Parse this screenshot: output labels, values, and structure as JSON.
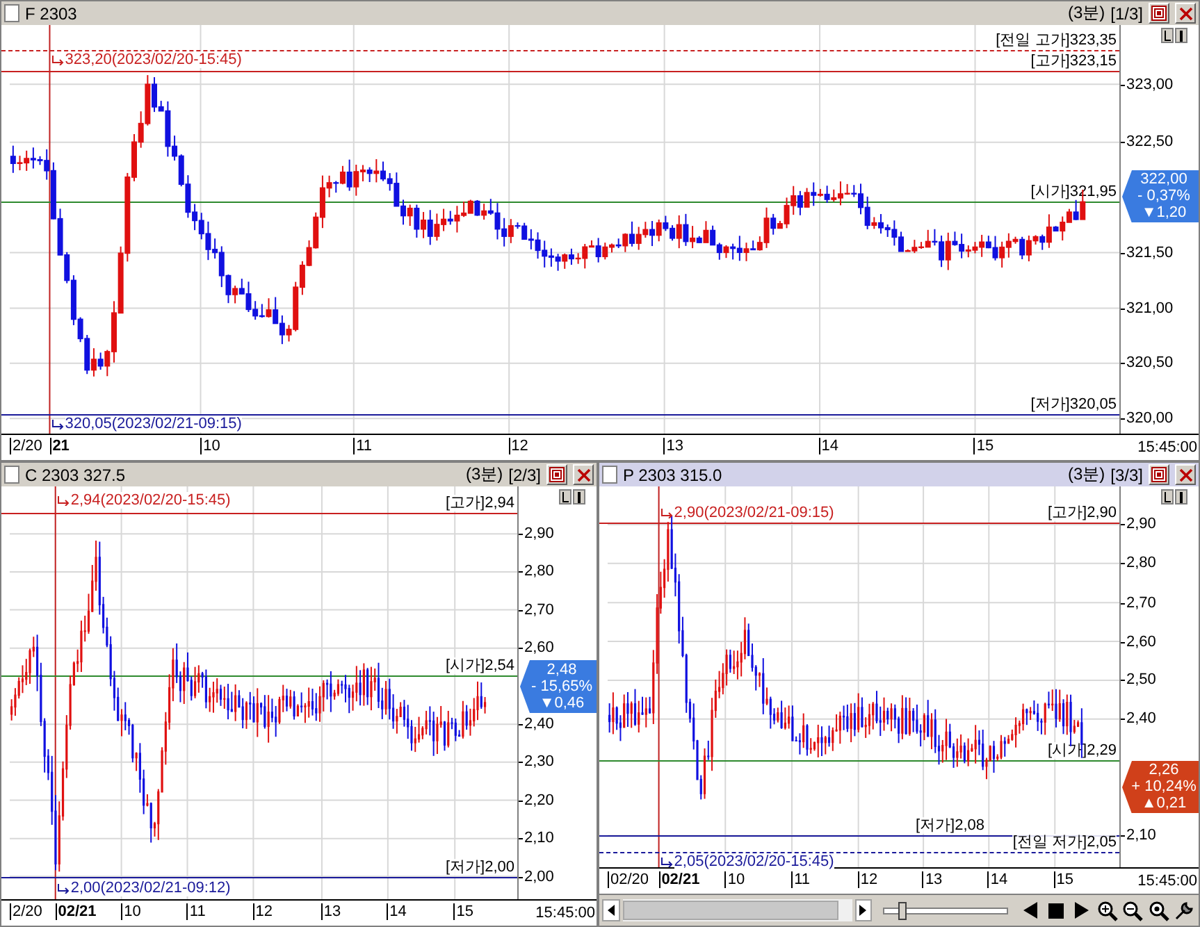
{
  "panels": [
    {
      "title": "F 2303",
      "interval": "(3분)",
      "page": "[1/3]",
      "active": false,
      "y_ticks": [
        "323,00",
        "322,50",
        "321,50",
        "321,00",
        "320,50",
        "320,00"
      ],
      "reference_lines": [
        {
          "kind": "prev_high",
          "label": "[전일 고가]323,35"
        },
        {
          "kind": "high",
          "label": "[고가]323,15"
        },
        {
          "kind": "open",
          "label": "[시가]321,95"
        },
        {
          "kind": "low",
          "label": "[저가]320,05"
        }
      ],
      "annotations": [
        {
          "kind": "high",
          "text": "323,20(2023/02/20-15:45)"
        },
        {
          "kind": "low",
          "text": "320,05(2023/02/21-09:15)"
        }
      ],
      "price_tag": {
        "rising": false,
        "price": "322,00",
        "change_percent": "- 0,37%",
        "change": "▼1,20"
      },
      "x_labels": [
        {
          "text": "2/20",
          "bold": false
        },
        {
          "text": "21",
          "bold": true
        },
        {
          "text": "10",
          "bold": false
        },
        {
          "text": "11",
          "bold": false
        },
        {
          "text": "12",
          "bold": false
        },
        {
          "text": "13",
          "bold": false
        },
        {
          "text": "14",
          "bold": false
        },
        {
          "text": "15",
          "bold": false
        }
      ],
      "x_end": "15:45:00"
    },
    {
      "title": "C 2303 327.5",
      "interval": "(3분)",
      "page": "[2/3]",
      "active": false,
      "y_ticks": [
        "2,90",
        "2,80",
        "2,70",
        "2,60",
        "2,40",
        "2,30",
        "2,20",
        "2,10",
        "2,00"
      ],
      "reference_lines": [
        {
          "kind": "high",
          "label": "[고가]2,94"
        },
        {
          "kind": "open",
          "label": "[시가]2,54"
        },
        {
          "kind": "low",
          "label": "[저가]2,00"
        }
      ],
      "annotations": [
        {
          "kind": "high",
          "text": "2,94(2023/02/20-15:45)"
        },
        {
          "kind": "low",
          "text": "2,00(2023/02/21-09:12)"
        }
      ],
      "price_tag": {
        "rising": false,
        "price": "2,48",
        "change_percent": "- 15,65%",
        "change": "▼0,46"
      },
      "x_labels": [
        {
          "text": "2/20",
          "bold": false
        },
        {
          "text": "02/21",
          "bold": true
        },
        {
          "text": "10",
          "bold": false
        },
        {
          "text": "11",
          "bold": false
        },
        {
          "text": "12",
          "bold": false
        },
        {
          "text": "13",
          "bold": false
        },
        {
          "text": "14",
          "bold": false
        },
        {
          "text": "15",
          "bold": false
        }
      ],
      "x_end": "15:45:00"
    },
    {
      "title": "P 2303 315.0",
      "interval": "(3분)",
      "page": "[3/3]",
      "active": true,
      "y_ticks": [
        "2,90",
        "2,80",
        "2,70",
        "2,60",
        "2,50",
        "2,40",
        "2,10"
      ],
      "reference_lines": [
        {
          "kind": "high",
          "label": "[고가]2,90"
        },
        {
          "kind": "open",
          "label": "[시가]2,29"
        },
        {
          "kind": "low",
          "label": "[저가]2,08"
        },
        {
          "kind": "prev_low",
          "label": "[전일 저가]2,05"
        }
      ],
      "annotations": [
        {
          "kind": "high",
          "text": "2,90(2023/02/21-09:15)"
        },
        {
          "kind": "low",
          "text": "2,05(2023/02/20-15:45)"
        }
      ],
      "price_tag": {
        "rising": true,
        "price": "2,26",
        "change_percent": "+ 10,24%",
        "change": "▲0,21"
      },
      "x_labels": [
        {
          "text": "02/20",
          "bold": false
        },
        {
          "text": "02/21",
          "bold": true
        },
        {
          "text": "10",
          "bold": false
        },
        {
          "text": "11",
          "bold": false
        },
        {
          "text": "12",
          "bold": false
        },
        {
          "text": "13",
          "bold": false
        },
        {
          "text": "14",
          "bold": false
        },
        {
          "text": "15",
          "bold": false
        }
      ],
      "x_end": "15:45:00"
    }
  ],
  "toolbar": {
    "zoom_slider": {
      "level": 0.12
    }
  }
}
